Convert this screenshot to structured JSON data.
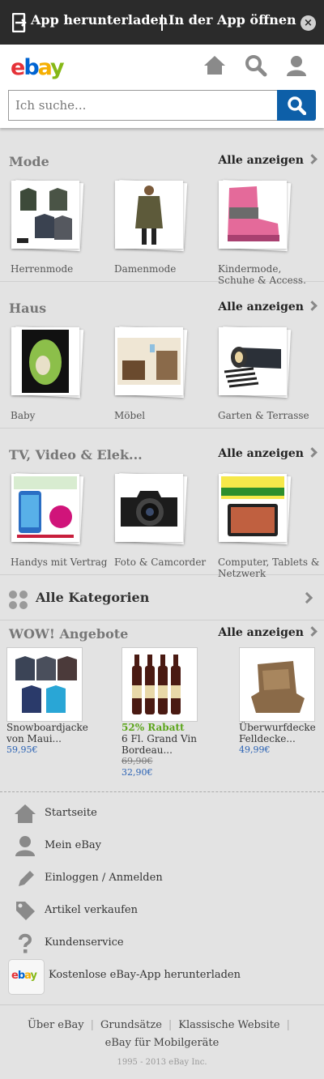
{
  "banner": {
    "download_label": "App herunterladen",
    "open_label": "In der App öffnen",
    "close_symbol": "×"
  },
  "header": {
    "logo": [
      "e",
      "b",
      "a",
      "y"
    ],
    "search_placeholder": "Ich suche..."
  },
  "sections": [
    {
      "title": "Mode",
      "all_label": "Alle anzeigen",
      "tiles": [
        {
          "label": "Herrenmode",
          "icon": "jackets-image"
        },
        {
          "label": "Damenmode",
          "icon": "parka-woman-image"
        },
        {
          "label": "Kindermode, Schuhe & Access.",
          "icon": "pink-boot-image"
        }
      ]
    },
    {
      "title": "Haus",
      "all_label": "Alle anzeigen",
      "tiles": [
        {
          "label": "Baby",
          "icon": "belly-cast-image"
        },
        {
          "label": "Möbel",
          "icon": "furniture-room-image"
        },
        {
          "label": "Garten & Terrasse",
          "icon": "garden-roll-image"
        }
      ]
    },
    {
      "title": "TV, Video & Elek...",
      "all_label": "Alle anzeigen",
      "tiles": [
        {
          "label": "Handys mit Vertrag",
          "icon": "smartphone-offer-image"
        },
        {
          "label": "Foto & Camcorder",
          "icon": "canon-camera-image"
        },
        {
          "label": "Computer, Tablets & Netzwerk",
          "icon": "tablet-offer-image"
        }
      ]
    }
  ],
  "all_categories": "Alle Kategorien",
  "deals": {
    "title": "WOW! Angebote",
    "all_label": "Alle anzeigen",
    "items": [
      {
        "title": "Snowboardjacke von Maui...",
        "discount": "",
        "old_price": "",
        "price": "59,95€"
      },
      {
        "title": "6 Fl. Grand Vin Bordeau...",
        "discount": "52% Rabatt",
        "old_price": "69,90€",
        "price": "32,90€"
      },
      {
        "title": "Überwurfdecke Felldecke...",
        "discount": "",
        "old_price": "",
        "price": "49,99€"
      }
    ]
  },
  "nav": [
    {
      "label": "Startseite",
      "icon": "home-icon"
    },
    {
      "label": "Mein eBay",
      "icon": "user-icon"
    },
    {
      "label": "Einloggen / Anmelden",
      "icon": "pencil-icon"
    },
    {
      "label": "Artikel verkaufen",
      "icon": "tag-icon"
    },
    {
      "label": "Kundenservice",
      "icon": "question-icon"
    },
    {
      "label": "Kostenlose eBay-App herunterladen",
      "icon": "ebay-app-icon"
    }
  ],
  "footer": {
    "links": [
      "Über eBay",
      "Grundsätze",
      "Klassische Website",
      "eBay für Mobilgeräte"
    ],
    "copyright": "1995 - 2013 eBay Inc."
  },
  "colors": {
    "banner_bg": "#2b2b2b",
    "search_button": "#0d5fa8",
    "discount_green": "#5ba51a",
    "price_blue": "#2a62b4"
  }
}
